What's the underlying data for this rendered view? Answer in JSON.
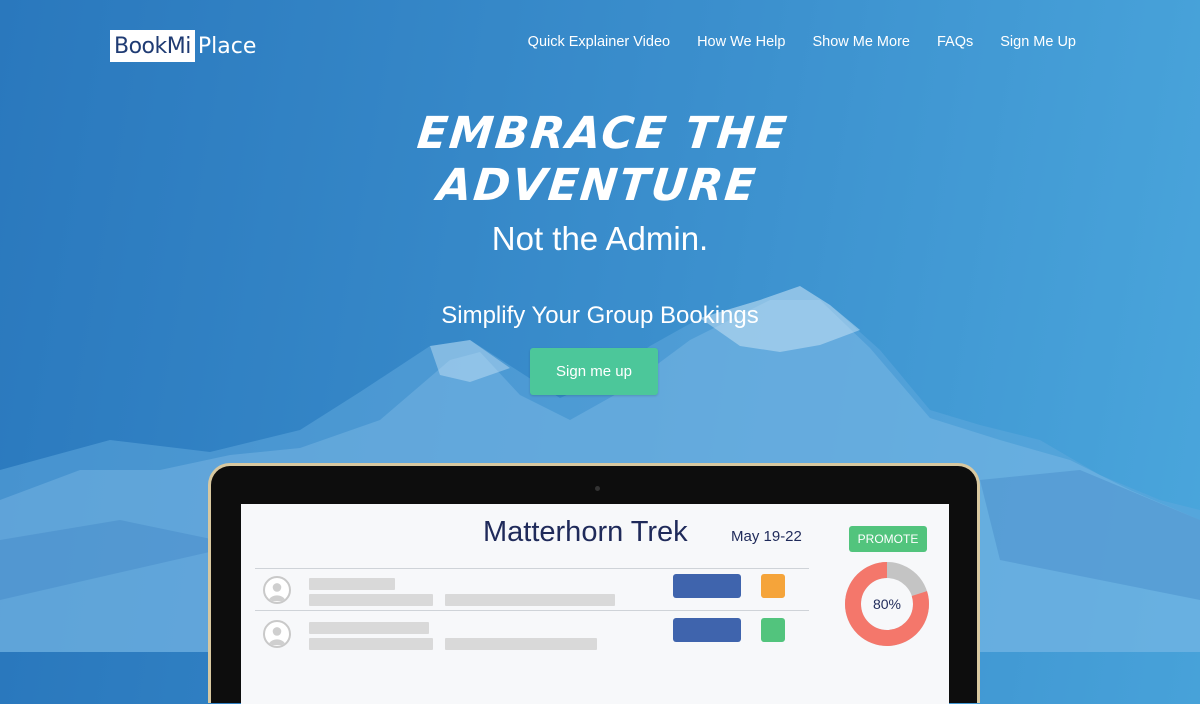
{
  "logo": {
    "part1": "BookMi",
    "part2": "Place"
  },
  "nav": [
    "Quick Explainer Video",
    "How We Help",
    "Show Me More",
    "FAQs",
    "Sign Me Up"
  ],
  "hero": {
    "title_line1": "Embrace the",
    "title_line2": "Adventure",
    "subtitle": "Not the Admin.",
    "tagline": "Simplify Your Group Bookings",
    "cta": "Sign me up"
  },
  "dashboard": {
    "title": "Matterhorn Trek",
    "date": "May 19-22",
    "promote": "PROMOTE",
    "progress_label": "80%",
    "progress_value": 0.8,
    "rows": [
      {
        "status_color": "#f5a43a"
      },
      {
        "status_color": "#52c47d"
      }
    ]
  },
  "colors": {
    "cta": "#4cc79a",
    "promote": "#52c47d",
    "row_button": "#3f64ad",
    "donut_fill": "#f4776b",
    "donut_rest": "#c4c4c4"
  }
}
